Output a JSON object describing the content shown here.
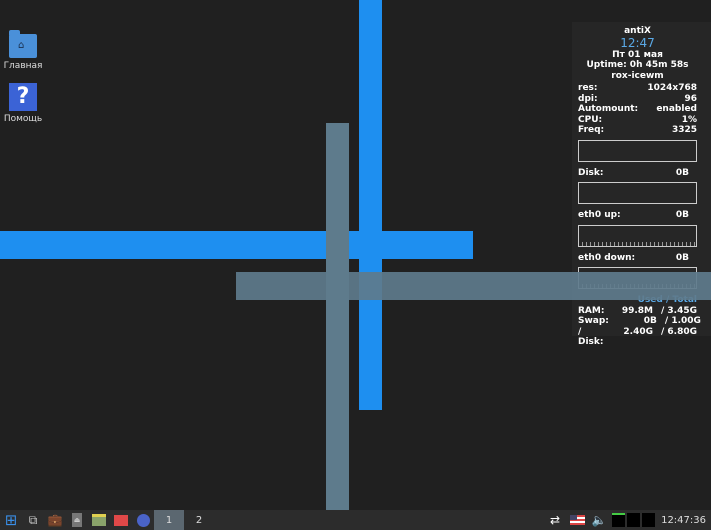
{
  "desktop": {
    "icons": [
      {
        "label": "Главная",
        "icon": "home-folder-icon"
      },
      {
        "label": "Помощь",
        "icon": "help-icon"
      }
    ]
  },
  "conky": {
    "distro": "antiX",
    "time": "12:47",
    "date": "Пт 01 мая",
    "uptime": "Uptime: 0h 45m 58s",
    "wm": "rox-icewm",
    "stats": [
      {
        "k": "res:",
        "v": "1024x768"
      },
      {
        "k": "dpi:",
        "v": "96"
      },
      {
        "k": "Automount:",
        "v": "enabled"
      },
      {
        "k": "CPU:",
        "v": "1%"
      },
      {
        "k": "Freq:",
        "v": "3325"
      }
    ],
    "disk": {
      "k": "Disk:",
      "v": "0B"
    },
    "eth_up": {
      "k": "eth0 up:",
      "v": "0B"
    },
    "eth_down": {
      "k": "eth0 down:",
      "v": "0B"
    },
    "mem_header": "Used / Total",
    "mem": [
      {
        "k": "RAM:",
        "u": "99.8M",
        "t": "/ 3.45G"
      },
      {
        "k": "Swap:",
        "u": "0B",
        "t": "/ 1.00G"
      },
      {
        "k": "/ Disk:",
        "u": "2.40G",
        "t": "/ 6.80G"
      }
    ]
  },
  "taskbar": {
    "workspaces": [
      "1",
      "2"
    ],
    "clock": "12:47:36"
  },
  "colors": {
    "accent": "#1e8ff0",
    "gray_bar": "#5e7b8c"
  }
}
